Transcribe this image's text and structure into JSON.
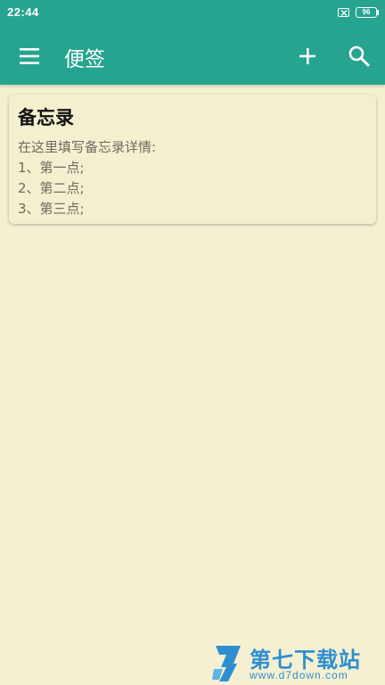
{
  "status_bar": {
    "time": "22:44",
    "battery": "96",
    "sim_icon": "sim-disabled-icon"
  },
  "app_bar": {
    "title": "便签",
    "menu_icon": "menu-icon",
    "add_icon": "plus-icon",
    "search_icon": "search-icon"
  },
  "notes": [
    {
      "title": "备忘录",
      "lines": [
        "在这里填写备忘录详情:",
        "1、第一点;",
        "2、第二点;",
        "3、第三点;"
      ]
    }
  ],
  "watermark": {
    "name": "第七下载站",
    "url": "www.d7down.com"
  },
  "colors": {
    "accent": "#26A48F",
    "background": "#F5F0D2",
    "card": "#F4EFCF",
    "watermark": "#2E8FD0"
  }
}
